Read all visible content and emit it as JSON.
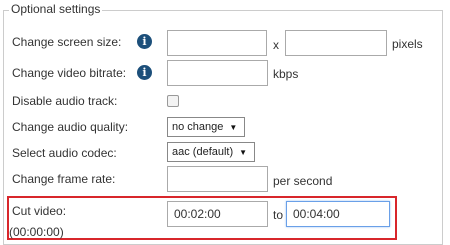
{
  "legend": "Optional settings",
  "screen_size": {
    "label": "Change screen size:",
    "width_value": "",
    "separator": "x",
    "height_value": "",
    "unit": "pixels"
  },
  "video_bitrate": {
    "label": "Change video bitrate:",
    "value": "",
    "unit": "kbps"
  },
  "disable_audio": {
    "label": "Disable audio track:",
    "checked": false
  },
  "audio_quality": {
    "label": "Change audio quality:",
    "selected": "no change"
  },
  "audio_codec": {
    "label": "Select audio codec:",
    "selected": "aac (default)"
  },
  "frame_rate": {
    "label": "Change frame rate:",
    "value": "",
    "unit": "per second"
  },
  "cut_video": {
    "label": "Cut video:",
    "hint": "(00:00:00)",
    "from_value": "00:02:00",
    "separator": "to",
    "to_value": "00:04:00"
  },
  "info_icon_glyph": "i",
  "select_arrow_glyph": "▼",
  "colors": {
    "highlight_border": "#d8262b",
    "info_icon": "#1c4f7a",
    "focus_border": "#6aa0e8"
  }
}
